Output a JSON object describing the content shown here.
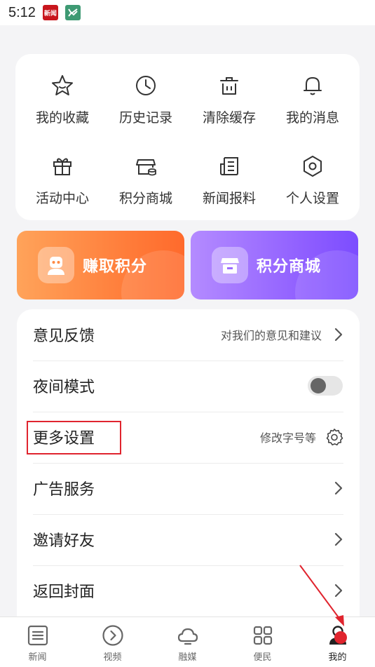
{
  "status": {
    "time": "5:12",
    "red_icon": "新闻"
  },
  "grid": {
    "items": [
      {
        "label": "我的收藏",
        "icon": "star-icon"
      },
      {
        "label": "历史记录",
        "icon": "clock-icon"
      },
      {
        "label": "清除缓存",
        "icon": "trash-icon"
      },
      {
        "label": "我的消息",
        "icon": "bell-icon"
      },
      {
        "label": "活动中心",
        "icon": "gift-icon"
      },
      {
        "label": "积分商城",
        "icon": "shop-icon"
      },
      {
        "label": "新闻报料",
        "icon": "news-report-icon"
      },
      {
        "label": "个人设置",
        "icon": "settings-hex-icon"
      }
    ]
  },
  "promo": {
    "earn": "赚取积分",
    "mall": "积分商城",
    "earn_color": "#ff7a38",
    "mall_color": "#8e5dff"
  },
  "list": {
    "feedback": {
      "title": "意见反馈",
      "hint": "对我们的意见和建议"
    },
    "night_mode": {
      "title": "夜间模式",
      "enabled": false
    },
    "more_settings": {
      "title": "更多设置",
      "hint": "修改字号等"
    },
    "ads": {
      "title": "广告服务"
    },
    "invite": {
      "title": "邀请好友"
    },
    "cover": {
      "title": "返回封面"
    }
  },
  "tabbar": {
    "items": [
      {
        "label": "新闻",
        "icon": "news-icon"
      },
      {
        "label": "视频",
        "icon": "play-circle-icon"
      },
      {
        "label": "融媒",
        "icon": "cloud-icon"
      },
      {
        "label": "便民",
        "icon": "grid-icon"
      },
      {
        "label": "我的",
        "icon": "person-icon",
        "active": true
      }
    ]
  },
  "annotation_color": "#e0242e"
}
